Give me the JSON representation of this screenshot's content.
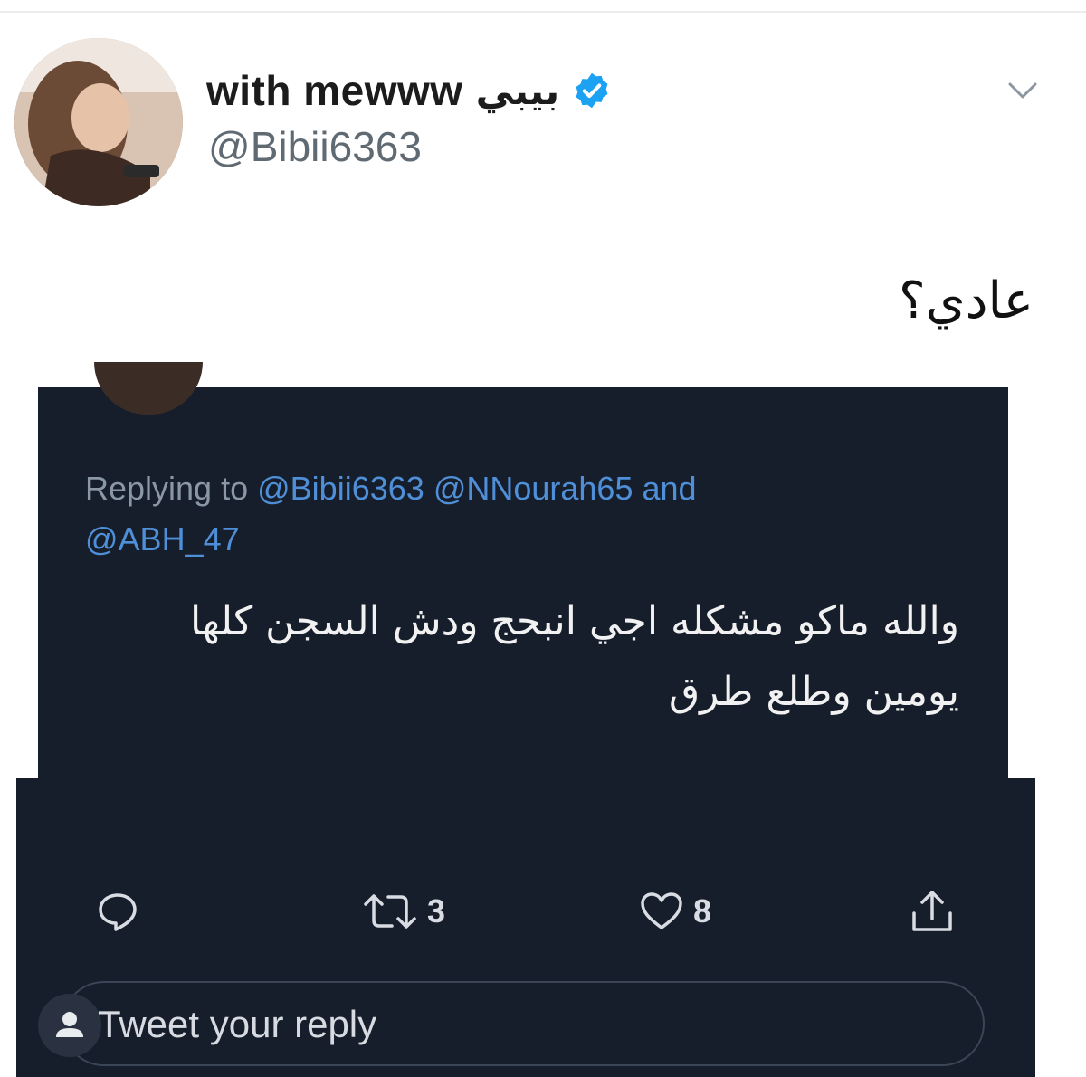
{
  "tweet": {
    "display_name": "with mewww",
    "display_name_ar": "بيبي",
    "handle": "@Bibii6363",
    "text": "عادي؟"
  },
  "quoted_screenshot": {
    "replying_prefix": "Replying to",
    "mentions": [
      "@Bibii6363",
      "@NNourah65",
      "@ABH_47"
    ],
    "and_word": "and",
    "reply_text": "والله ماكو مشكله اجي انبحج ودش السجن كلها يومين وطلع طرق",
    "retweet_count": "3",
    "like_count": "8",
    "reply_placeholder": "Tweet your reply"
  },
  "icons": {
    "verified": "verified-badge-icon",
    "chevron": "chevron-down-icon",
    "reply": "reply-bubble-icon",
    "retweet": "retweet-icon",
    "like": "heart-icon",
    "share": "share-icon",
    "user": "user-icon"
  },
  "colors": {
    "verified_blue": "#1da1f2",
    "mention_blue": "#4f8fd8",
    "dark_bg": "#161d2b"
  }
}
